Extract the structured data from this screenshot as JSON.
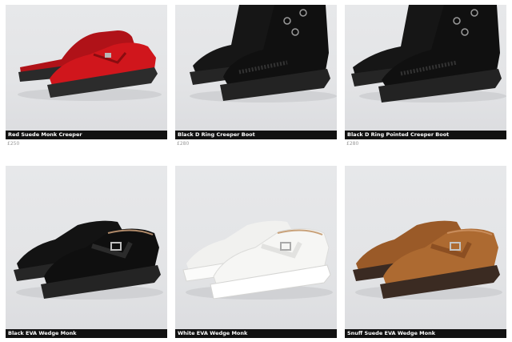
{
  "products": [
    {
      "title": "Red Suede Monk Creeper",
      "price": "£250",
      "color": "#c8141a",
      "icon": "red-suede-monk-creeper-image"
    },
    {
      "title": "Black D Ring Creeper Boot",
      "price": "£280",
      "color": "#121212",
      "icon": "black-d-ring-creeper-boot-image"
    },
    {
      "title": "Black D Ring Pointed Creeper Boot",
      "price": "£280",
      "color": "#121212",
      "icon": "black-d-ring-pointed-creeper-boot-image"
    },
    {
      "title": "Black EVA Wedge Monk",
      "price": "",
      "color": "#151515",
      "icon": "black-eva-wedge-monk-image"
    },
    {
      "title": "White EVA Wedge Monk",
      "price": "",
      "color": "#f4f4f2",
      "icon": "white-eva-wedge-monk-image"
    },
    {
      "title": "Snuff Suede EVA Wedge Monk",
      "price": "",
      "color": "#a8652e",
      "icon": "snuff-suede-eva-wedge-monk-image"
    }
  ]
}
